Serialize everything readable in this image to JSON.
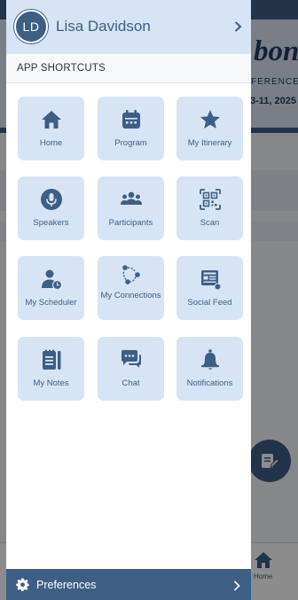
{
  "background": {
    "banner_title": "bon",
    "banner_sub": "FERENCE",
    "banner_date": "3-11, 2025",
    "bottom_nav_home_label": "Home"
  },
  "drawer": {
    "avatar_initials": "LD",
    "user_name": "Lisa Davidson",
    "section_title": "APP SHORTCUTS",
    "shortcuts": [
      {
        "label": "Home",
        "icon": "home-icon"
      },
      {
        "label": "Program",
        "icon": "calendar-icon"
      },
      {
        "label": "My Itinerary",
        "icon": "star-icon"
      },
      {
        "label": "Speakers",
        "icon": "microphone-icon"
      },
      {
        "label": "Participants",
        "icon": "people-icon"
      },
      {
        "label": "Scan",
        "icon": "qr-code-icon"
      },
      {
        "label": "My Scheduler",
        "icon": "person-clock-icon"
      },
      {
        "label": "My Connections",
        "icon": "connections-icon"
      },
      {
        "label": "Social Feed",
        "icon": "social-feed-icon"
      },
      {
        "label": "My Notes",
        "icon": "notes-icon"
      },
      {
        "label": "Chat",
        "icon": "chat-icon"
      },
      {
        "label": "Notifications",
        "icon": "bell-icon"
      }
    ],
    "footer_label": "Preferences"
  },
  "colors": {
    "primary": "#3d5f86",
    "tile_background": "#d6e4f5",
    "scrim": "rgba(0,0,0,0.45)"
  }
}
